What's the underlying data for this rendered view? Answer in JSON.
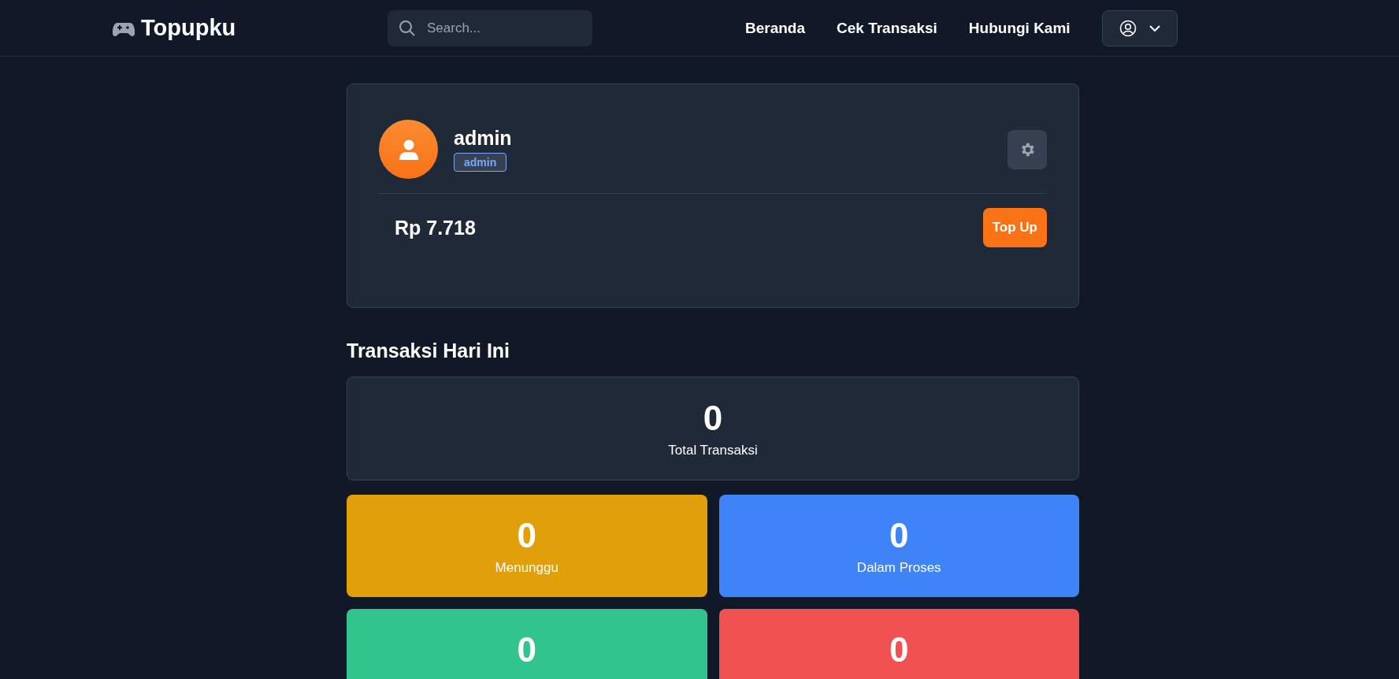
{
  "header": {
    "logo": "Topupku",
    "search": {
      "placeholder": "Search..."
    },
    "nav": [
      "Beranda",
      "Cek Transaksi",
      "Hubungi Kami"
    ]
  },
  "profile": {
    "name": "admin",
    "role": "admin",
    "balance": "Rp 7.718",
    "top_up": "Top Up"
  },
  "section_title": "Transaksi Hari Ini",
  "total": {
    "value": "0",
    "label": "Total Transaksi"
  },
  "stats": [
    {
      "value": "0",
      "label": "Menunggu",
      "color": "#e1a009"
    },
    {
      "value": "0",
      "label": "Dalam Proses",
      "color": "#3f83f8"
    },
    {
      "value": "0",
      "color": "#31c48d"
    },
    {
      "value": "0",
      "color": "#f05252"
    }
  ]
}
